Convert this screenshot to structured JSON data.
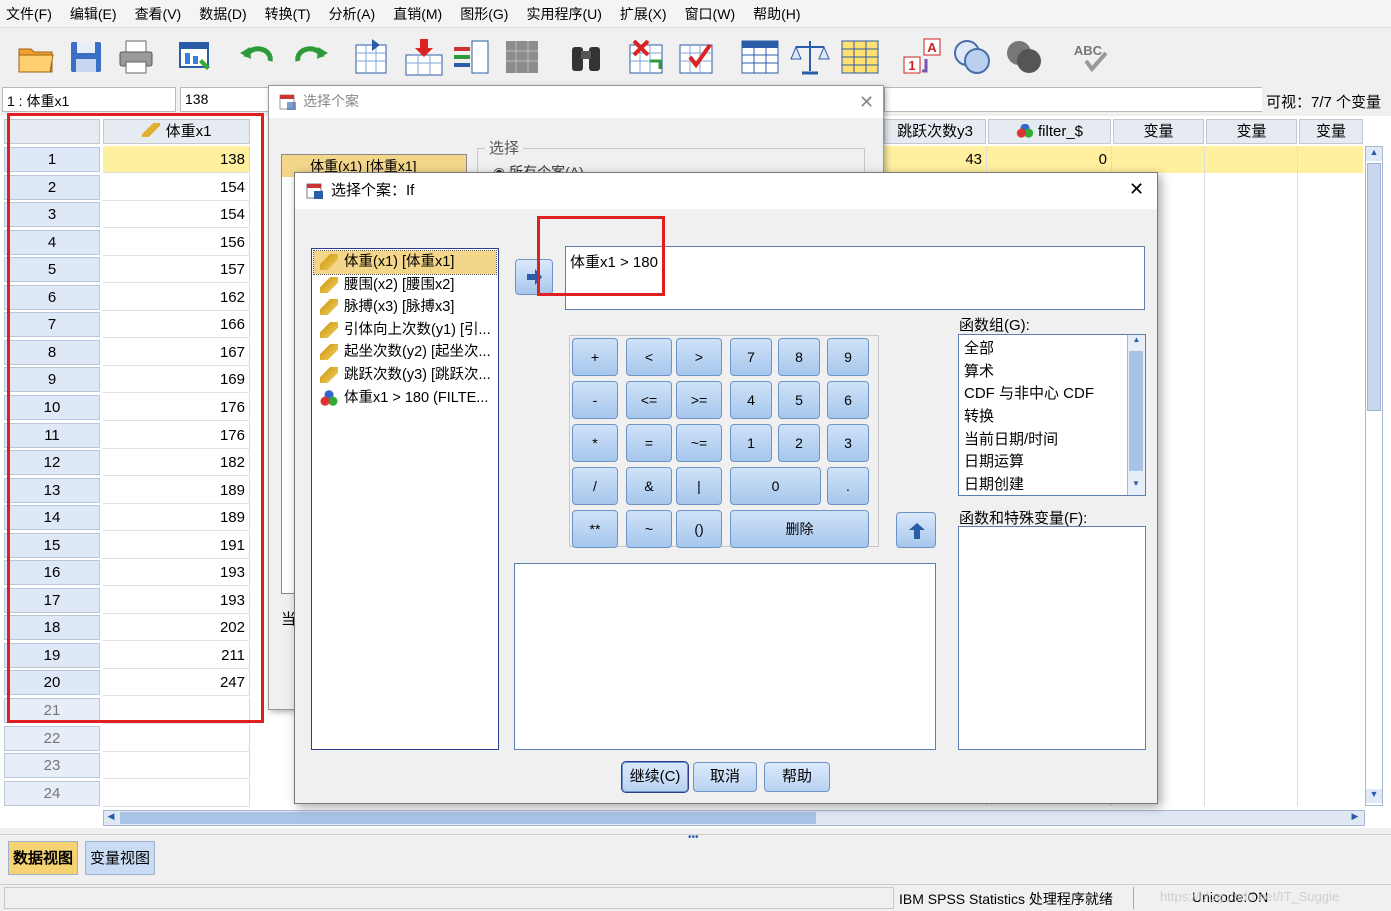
{
  "menu": [
    "文件(F)",
    "编辑(E)",
    "查看(V)",
    "数据(D)",
    "转换(T)",
    "分析(A)",
    "直销(M)",
    "图形(G)",
    "实用程序(U)",
    "扩展(X)",
    "窗口(W)",
    "帮助(H)"
  ],
  "toolbar": {
    "icons": [
      "open-folder-icon",
      "save-icon",
      "print-icon",
      "recall-dialog-icon",
      "undo-icon",
      "redo-icon",
      "goto-case-icon",
      "goto-variable-icon",
      "variables-icon",
      "run-descriptive-icon",
      "find-icon",
      "insert-cases-icon",
      "insert-variable-icon",
      "split-file-icon",
      "weight-cases-icon",
      "select-cases-icon",
      "value-labels-icon",
      "use-sets-icon",
      "show-all-variables-icon",
      "spell-check-icon"
    ]
  },
  "cellbar": {
    "ref": "1 : 体重x1",
    "value": "138",
    "visible": "可视：7/7 个变量"
  },
  "grid": {
    "col1_header": "体重x1",
    "other_headers": [
      {
        "label": "跳跃次数y3",
        "type": "scale"
      },
      {
        "label": "filter_$",
        "type": "nominal"
      },
      {
        "label": "变量",
        "type": "empty"
      },
      {
        "label": "变量",
        "type": "empty"
      },
      {
        "label": "变量",
        "type": "empty"
      }
    ],
    "row_numbers": [
      "1",
      "2",
      "3",
      "4",
      "5",
      "6",
      "7",
      "8",
      "9",
      "10",
      "11",
      "12",
      "13",
      "14",
      "15",
      "16",
      "17",
      "18",
      "19",
      "20",
      "21",
      "22",
      "23",
      "24"
    ],
    "col1_values": [
      "138",
      "154",
      "154",
      "156",
      "157",
      "162",
      "166",
      "167",
      "169",
      "176",
      "176",
      "182",
      "189",
      "189",
      "191",
      "193",
      "193",
      "202",
      "211",
      "247"
    ],
    "row1_y3": "43",
    "row1_filter": "0"
  },
  "back_dialog": {
    "title": "选择个案",
    "group_label": "选择",
    "radio_all": "所有个案(A)",
    "list_first": "体重(x1) [体重x1]",
    "current_label": "当"
  },
  "dialog": {
    "title": "选择个案：If",
    "variables": [
      {
        "label": "体重(x1) [体重x1]",
        "icon": "scale-ruler-icon",
        "selected": true
      },
      {
        "label": "腰围(x2) [腰围x2]",
        "icon": "scale-ruler-icon"
      },
      {
        "label": "脉搏(x3) [脉搏x3]",
        "icon": "scale-ruler-icon"
      },
      {
        "label": "引体向上次数(y1) [引...",
        "icon": "scale-ruler-icon"
      },
      {
        "label": "起坐次数(y2) [起坐次...",
        "icon": "scale-ruler-icon"
      },
      {
        "label": "跳跃次数(y3) [跳跃次...",
        "icon": "scale-ruler-icon"
      },
      {
        "label": "体重x1 > 180 (FILTE...",
        "icon": "nominal-filter-icon"
      }
    ],
    "expression": "体重x1 > 180",
    "keypad": {
      "ops": [
        "+",
        "<",
        ">",
        "-",
        "<=",
        ">=",
        "*",
        "=",
        "~=",
        "/",
        "&",
        "|",
        "**",
        "~",
        "()"
      ],
      "digits": [
        "7",
        "8",
        "9",
        "4",
        "5",
        "6",
        "1",
        "2",
        "3",
        "0",
        "."
      ],
      "delete": "删除"
    },
    "function_group_label": "函数组(G):",
    "function_groups": [
      "全部",
      "算术",
      "CDF 与非中心 CDF",
      "转换",
      "当前日期/时间",
      "日期运算",
      "日期创建"
    ],
    "functions_label": "函数和特殊变量(F):",
    "buttons": {
      "continue": "继续(C)",
      "cancel": "取消",
      "help": "帮助"
    }
  },
  "tabs": {
    "data_view": "数据视图",
    "variable_view": "变量视图"
  },
  "status": {
    "processor": "IBM SPSS Statistics 处理程序就绪",
    "unicode": "Unicode:ON",
    "watermark": "https://blog.csdn.net/IT_Suggie"
  }
}
